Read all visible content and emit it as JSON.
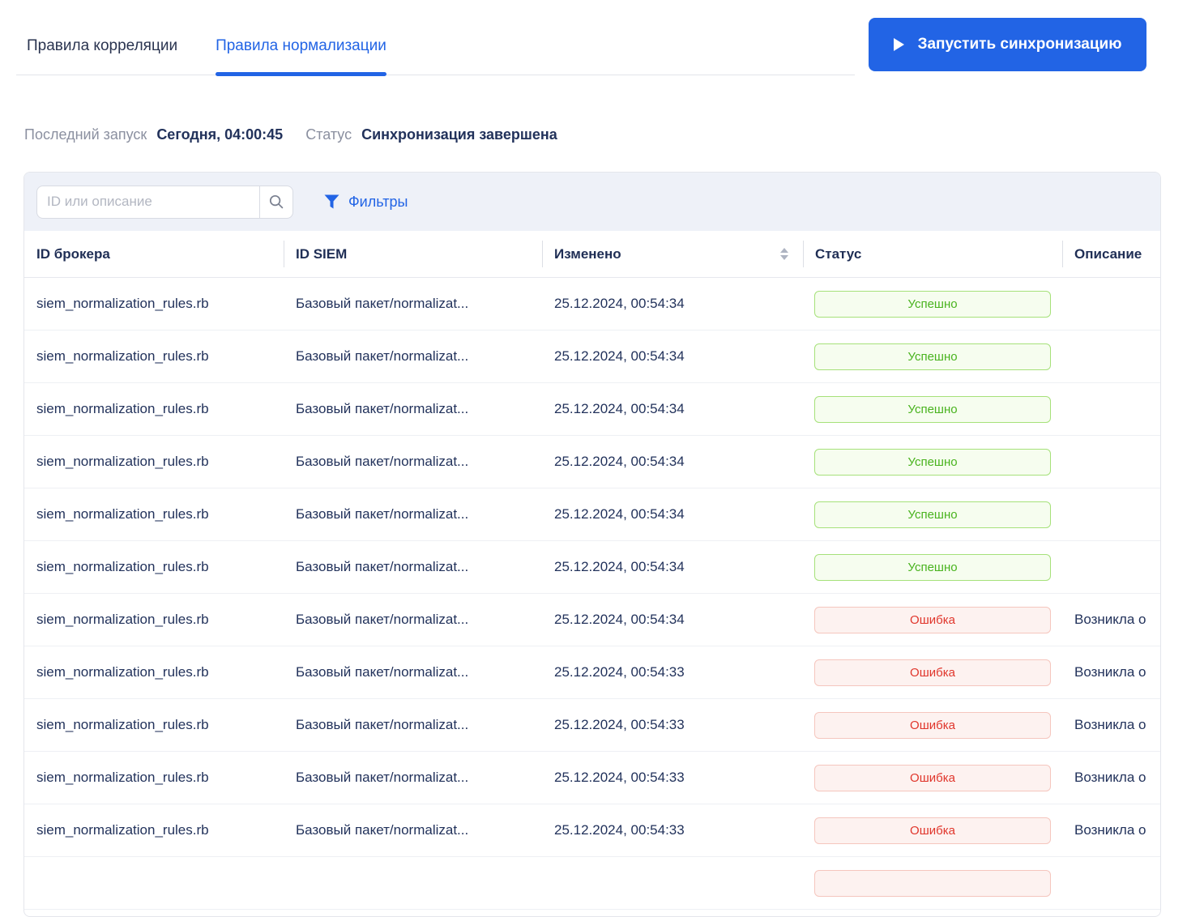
{
  "tabs": [
    {
      "label": "Правила корреляции",
      "active": false
    },
    {
      "label": "Правила нормализации",
      "active": true
    }
  ],
  "sync_button": {
    "label": "Запустить синхронизацию",
    "icon": "play-icon"
  },
  "last_run": {
    "label": "Последний запуск",
    "value": "Сегодня, 04:00:45"
  },
  "sync_status": {
    "label": "Статус",
    "value": "Синхронизация завершена"
  },
  "toolbar": {
    "search_placeholder": "ID или описание",
    "search_value": "",
    "search_icon": "magnifier-icon",
    "filter_icon": "funnel-icon",
    "filters_label": "Фильтры"
  },
  "table": {
    "columns": [
      "ID брокера",
      "ID SIEM",
      "Изменено",
      "Статус",
      "Описание"
    ],
    "sorted_column": "Изменено",
    "rows": [
      {
        "broker_id": "siem_normalization_rules.rb",
        "siem_id": "Базовый пакет/normalizat...",
        "modified": "25.12.2024, 00:54:34",
        "status": "Успешно",
        "status_type": "success",
        "description": ""
      },
      {
        "broker_id": "siem_normalization_rules.rb",
        "siem_id": "Базовый пакет/normalizat...",
        "modified": "25.12.2024, 00:54:34",
        "status": "Успешно",
        "status_type": "success",
        "description": ""
      },
      {
        "broker_id": "siem_normalization_rules.rb",
        "siem_id": "Базовый пакет/normalizat...",
        "modified": "25.12.2024, 00:54:34",
        "status": "Успешно",
        "status_type": "success",
        "description": ""
      },
      {
        "broker_id": "siem_normalization_rules.rb",
        "siem_id": "Базовый пакет/normalizat...",
        "modified": "25.12.2024, 00:54:34",
        "status": "Успешно",
        "status_type": "success",
        "description": ""
      },
      {
        "broker_id": "siem_normalization_rules.rb",
        "siem_id": "Базовый пакет/normalizat...",
        "modified": "25.12.2024, 00:54:34",
        "status": "Успешно",
        "status_type": "success",
        "description": ""
      },
      {
        "broker_id": "siem_normalization_rules.rb",
        "siem_id": "Базовый пакет/normalizat...",
        "modified": "25.12.2024, 00:54:34",
        "status": "Успешно",
        "status_type": "success",
        "description": ""
      },
      {
        "broker_id": "siem_normalization_rules.rb",
        "siem_id": "Базовый пакет/normalizat...",
        "modified": "25.12.2024, 00:54:34",
        "status": "Ошибка",
        "status_type": "error",
        "description": "Возникла о"
      },
      {
        "broker_id": "siem_normalization_rules.rb",
        "siem_id": "Базовый пакет/normalizat...",
        "modified": "25.12.2024, 00:54:33",
        "status": "Ошибка",
        "status_type": "error",
        "description": "Возникла о"
      },
      {
        "broker_id": "siem_normalization_rules.rb",
        "siem_id": "Базовый пакет/normalizat...",
        "modified": "25.12.2024, 00:54:33",
        "status": "Ошибка",
        "status_type": "error",
        "description": "Возникла о"
      },
      {
        "broker_id": "siem_normalization_rules.rb",
        "siem_id": "Базовый пакет/normalizat...",
        "modified": "25.12.2024, 00:54:33",
        "status": "Ошибка",
        "status_type": "error",
        "description": "Возникла о"
      },
      {
        "broker_id": "siem_normalization_rules.rb",
        "siem_id": "Базовый пакет/normalizat...",
        "modified": "25.12.2024, 00:54:33",
        "status": "Ошибка",
        "status_type": "error",
        "description": "Возникла о"
      },
      {
        "broker_id": "",
        "siem_id": "",
        "modified": "",
        "status": "",
        "status_type": "error",
        "description": ""
      }
    ]
  },
  "colors": {
    "accent_blue": "#2264E5",
    "text_dark": "#22325B",
    "text_gray": "#8B90A0",
    "toolbar_bg": "#EEF1F8",
    "success_text": "#49B31E",
    "success_border": "#A6E17A",
    "success_bg": "#F6FDEF",
    "error_text": "#E0352B",
    "error_border": "#F5C6BE",
    "error_bg": "#FDF2F0"
  }
}
